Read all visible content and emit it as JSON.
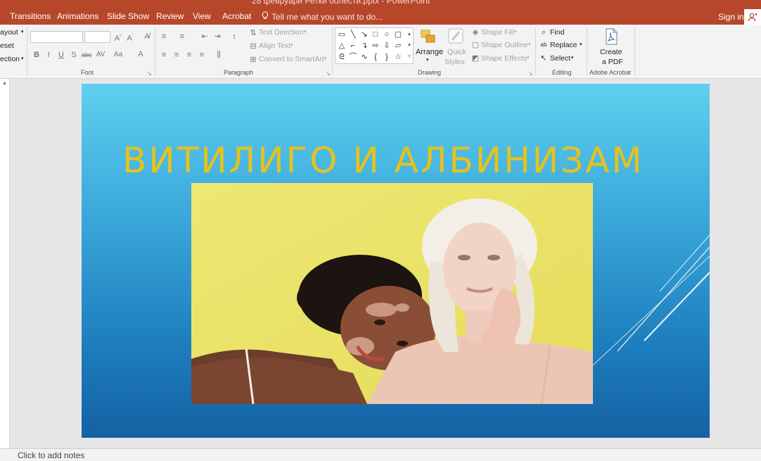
{
  "window": {
    "doc_title": "28 февруари Ретки болести.pptx - PowerPoint"
  },
  "tabs": [
    "Transitions",
    "Animations",
    "Slide Show",
    "Review",
    "View",
    "Acrobat"
  ],
  "tell_me": "Tell me what you want to do...",
  "sign_in": "Sign in",
  "ribbon": {
    "slides_group": {
      "layout": "ayout",
      "reset": "eset",
      "section": "ection"
    },
    "font_group": {
      "label": "Font",
      "bold": "B",
      "italic": "I",
      "underline": "U",
      "shadow": "S",
      "strike": "abc",
      "spacing": "AV",
      "case": "Aa",
      "font_color": "A"
    },
    "paragraph_group": {
      "label": "Paragraph",
      "text_direction": "Text Direction",
      "align_text": "Align Text",
      "convert_smartart": "Convert to SmartArt"
    },
    "drawing_group": {
      "label": "Drawing",
      "arrange": "Arrange",
      "quick_styles_1": "Quick",
      "quick_styles_2": "Styles",
      "shape_fill": "Shape Fill",
      "shape_outline": "Shape Outline",
      "shape_effects": "Shape Effects"
    },
    "editing_group": {
      "label": "Editing",
      "find": "Find",
      "replace": "Replace",
      "select": "Select"
    },
    "acrobat_group": {
      "label": "Adobe Acrobat",
      "create_1": "Create",
      "create_2": "a PDF"
    }
  },
  "slide": {
    "title": "ВИТИЛИГО И АЛБИНИЗАМ"
  },
  "notes": {
    "placeholder": "Click to add notes"
  },
  "colors": {
    "ribbon_accent": "#b7472a",
    "slide_title": "#e6c21d",
    "photo_background": "#e9e26a"
  }
}
